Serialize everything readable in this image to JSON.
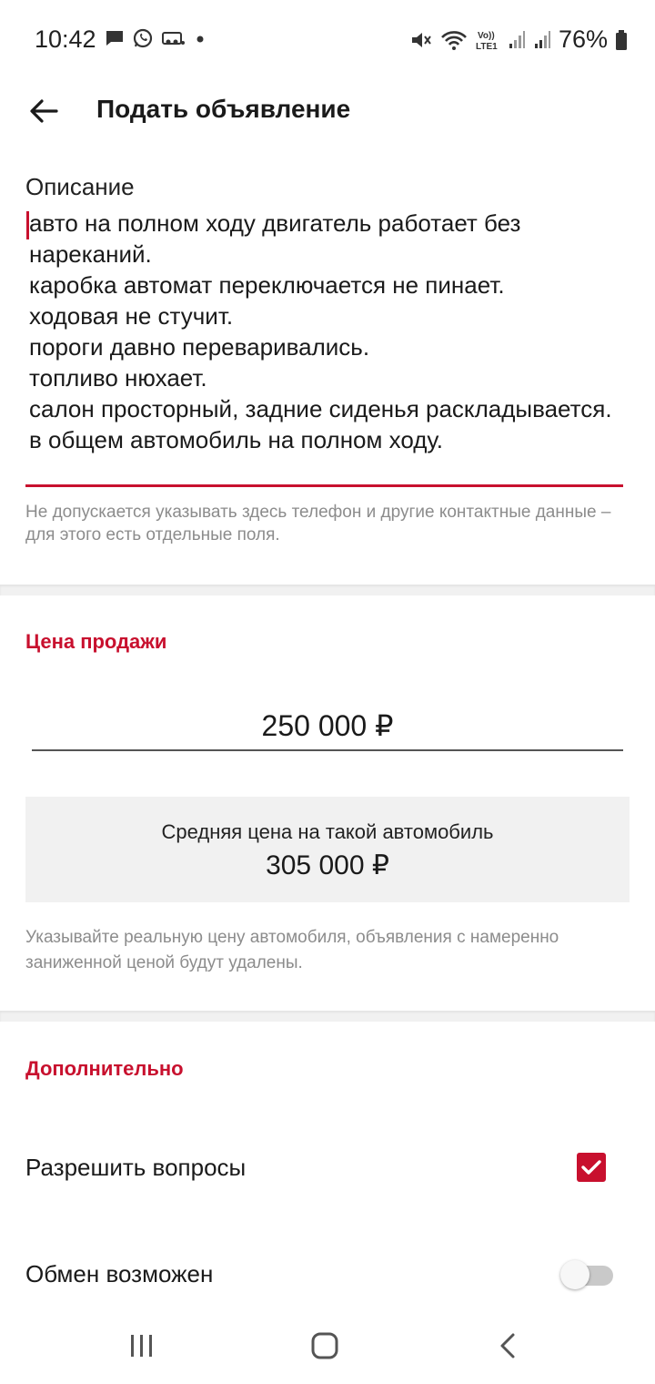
{
  "status_bar": {
    "time": "10:42",
    "battery_percent": "76%",
    "left_icons": [
      "message-icon",
      "whatsapp-icon",
      "voicemail-icon",
      "dot-icon"
    ],
    "right_icons": [
      "mute-icon",
      "wifi-icon",
      "volte-icon",
      "signal-icon",
      "signal-icon",
      "battery-icon"
    ]
  },
  "app_bar": {
    "title": "Подать объявление",
    "back_icon": "arrow-left-icon"
  },
  "description": {
    "label": "Описание",
    "value": "авто на полном ходу двигатель работает без нареканий.\nкаробка автомат переключается не пинает.\nходовая не стучит.\nпороги давно переваривались.\nтопливо нюхает.\nсалон просторный, задние сиденья раскладывается.\nв общем автомобиль на полном ходу.",
    "hint": "Не допускается указывать здесь телефон и другие контактные данные – для этого есть отдельные поля."
  },
  "price": {
    "section_title": "Цена продажи",
    "value": "250 000 ₽",
    "average_label": "Средняя цена на такой автомобиль",
    "average_value": "305 000 ₽",
    "hint": "Указывайте реальную цену автомобиля, объявления с намеренно заниженной ценой будут удалены."
  },
  "extra": {
    "section_title": "Дополнительно",
    "allow_questions_label": "Разрешить вопросы",
    "allow_questions_checked": true,
    "exchange_label": "Обмен возможен",
    "exchange_enabled": false
  },
  "colors": {
    "accent": "#c8102e",
    "hint_text": "#8c8c8c",
    "panel_bg": "#f1f1f1"
  },
  "nav_bar": {
    "icons": [
      "recent-apps-icon",
      "home-icon",
      "back-icon"
    ]
  }
}
